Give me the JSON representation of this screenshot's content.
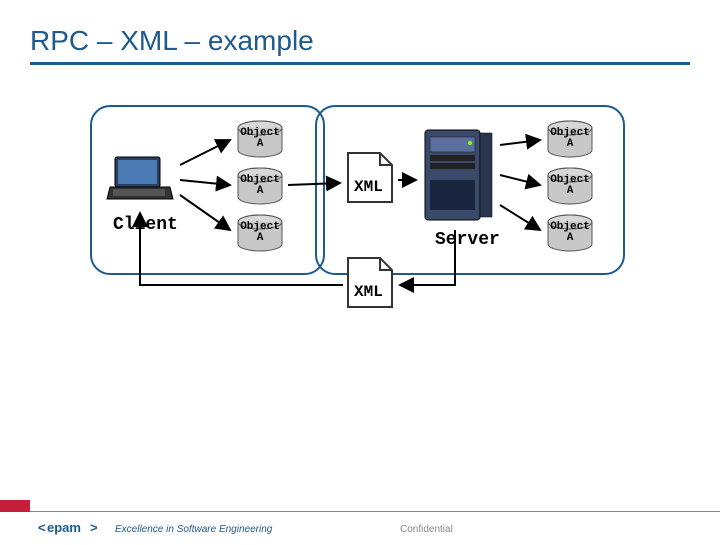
{
  "title": "RPC – XML – example",
  "diagram": {
    "client_label": "Client",
    "server_label": "Server",
    "xml_request": "XML",
    "xml_response": "XML",
    "client_objects": [
      {
        "label": "Object A"
      },
      {
        "label": "Object A"
      },
      {
        "label": "Object A"
      }
    ],
    "server_objects": [
      {
        "label": "Object A"
      },
      {
        "label": "Object A"
      },
      {
        "label": "Object A"
      }
    ]
  },
  "footer": {
    "tagline": "Excellence in Software Engineering",
    "confidential": "Confidential",
    "logo_text": "epam"
  }
}
